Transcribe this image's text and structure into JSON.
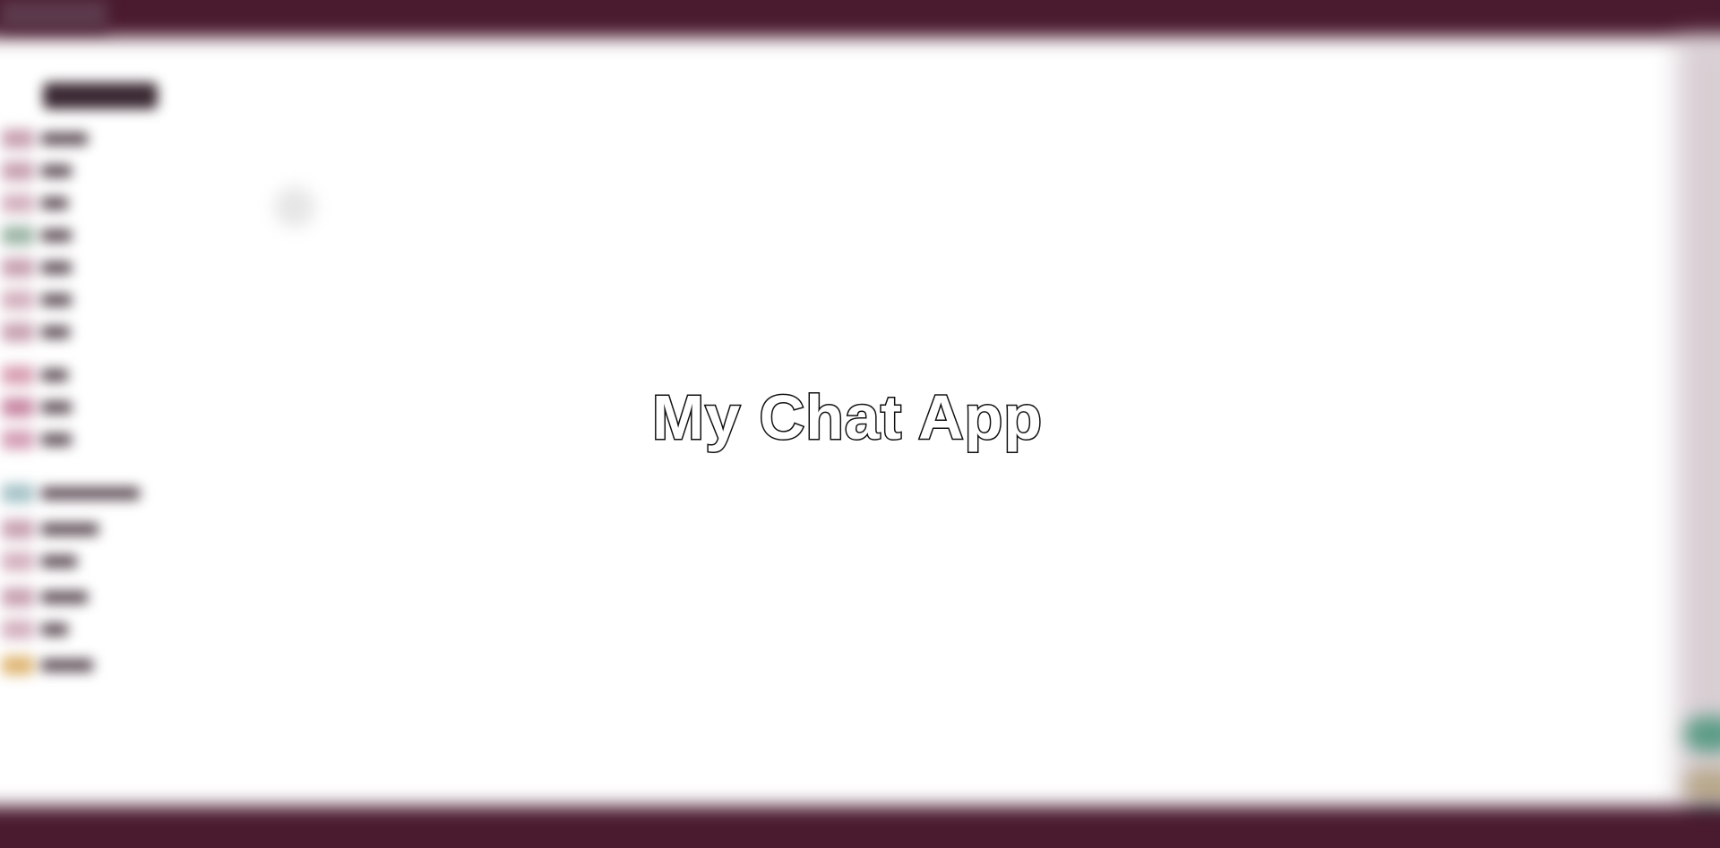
{
  "app": {
    "title": "My Chat App"
  },
  "theme": {
    "bar_color": "#4a1a2e",
    "background": "#ffffff",
    "title_fill": "#ffffff",
    "title_outline": "#111111"
  },
  "sidebar": {
    "rows": [
      {
        "avatar_color": "#c9a3b3",
        "text_width": 52
      },
      {
        "avatar_color": "#c9a3b3",
        "text_width": 34
      },
      {
        "avatar_color": "#d4b2bf",
        "text_width": 30
      },
      {
        "avatar_color": "#9fb7a8",
        "text_width": 34
      },
      {
        "avatar_color": "#c9a3b3",
        "text_width": 34
      },
      {
        "avatar_color": "#d4b2bf",
        "text_width": 34
      },
      {
        "avatar_color": "#c9a3b3",
        "text_width": 32
      },
      {
        "avatar_color": "#d9a0b4",
        "text_width": 30
      },
      {
        "avatar_color": "#c98aa5",
        "text_width": 34
      },
      {
        "avatar_color": "#d4a0b6",
        "text_width": 34
      },
      {
        "avatar_color": "#a8c4c9",
        "text_width": 110
      },
      {
        "avatar_color": "#c9a3b3",
        "text_width": 64
      },
      {
        "avatar_color": "#d4b2bf",
        "text_width": 40
      },
      {
        "avatar_color": "#c9a3b3",
        "text_width": 52
      },
      {
        "avatar_color": "#d4b2bf",
        "text_width": 30
      },
      {
        "avatar_color": "#e0b878",
        "text_width": 58
      }
    ]
  },
  "right_edge": {
    "bubble_colors": [
      "#5c9c86",
      "#b8a98c",
      "#4f8f78"
    ]
  }
}
